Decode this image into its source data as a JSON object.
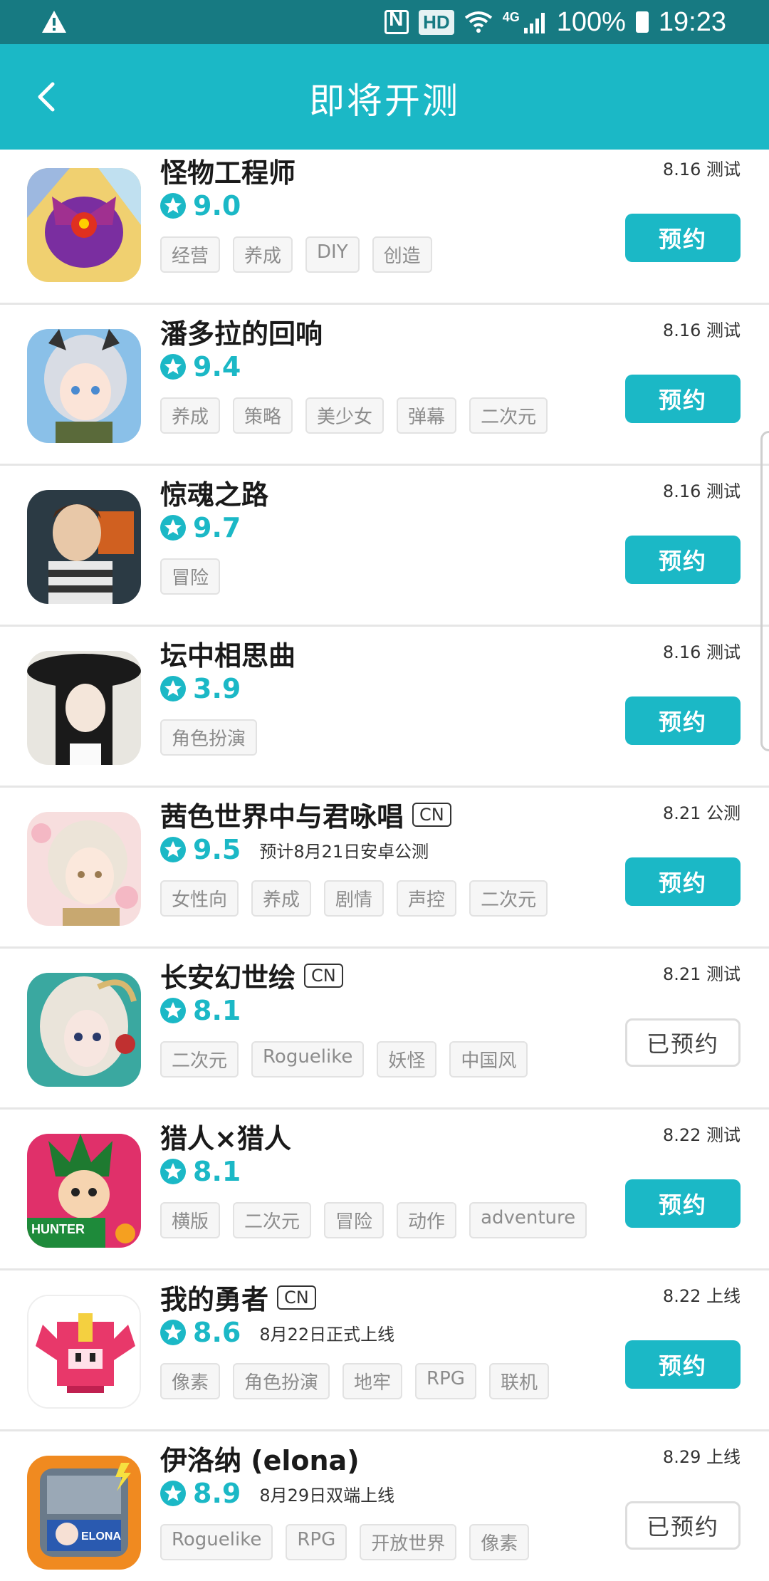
{
  "status_bar": {
    "battery": "100%",
    "time": "19:23",
    "network": "4G",
    "hd": "HD"
  },
  "header": {
    "title": "即将开测"
  },
  "games": [
    {
      "name": "怪物工程师",
      "cn": "",
      "score": "9.0",
      "note": "",
      "tags": [
        "经营",
        "养成",
        "DIY",
        "创造"
      ],
      "date": "8.16 测试",
      "button": "预约",
      "reserved": false
    },
    {
      "name": "潘多拉的回响",
      "cn": "",
      "score": "9.4",
      "note": "",
      "tags": [
        "养成",
        "策略",
        "美少女",
        "弹幕",
        "二次元"
      ],
      "date": "8.16 测试",
      "button": "预约",
      "reserved": false
    },
    {
      "name": "惊魂之路",
      "cn": "",
      "score": "9.7",
      "note": "",
      "tags": [
        "冒险"
      ],
      "date": "8.16 测试",
      "button": "预约",
      "reserved": false
    },
    {
      "name": "坛中相思曲",
      "cn": "",
      "score": "3.9",
      "note": "",
      "tags": [
        "角色扮演"
      ],
      "date": "8.16 测试",
      "button": "预约",
      "reserved": false
    },
    {
      "name": "茜色世界中与君咏唱",
      "cn": "CN",
      "score": "9.5",
      "note": "预计8月21日安卓公测",
      "tags": [
        "女性向",
        "养成",
        "剧情",
        "声控",
        "二次元"
      ],
      "date": "8.21 公测",
      "button": "预约",
      "reserved": false
    },
    {
      "name": "长安幻世绘",
      "cn": "CN",
      "score": "8.1",
      "note": "",
      "tags": [
        "二次元",
        "Roguelike",
        "妖怪",
        "中国风"
      ],
      "date": "8.21 测试",
      "button": "已预约",
      "reserved": true
    },
    {
      "name": "猎人×猎人",
      "cn": "",
      "score": "8.1",
      "note": "",
      "tags": [
        "横版",
        "二次元",
        "冒险",
        "动作",
        "adventure"
      ],
      "date": "8.22 测试",
      "button": "预约",
      "reserved": false
    },
    {
      "name": "我的勇者",
      "cn": "CN",
      "score": "8.6",
      "note": "8月22日正式上线",
      "tags": [
        "像素",
        "角色扮演",
        "地牢",
        "RPG",
        "联机"
      ],
      "date": "8.22 上线",
      "button": "预约",
      "reserved": false
    },
    {
      "name": "伊洛纳 (elona)",
      "cn": "",
      "score": "8.9",
      "note": "8月29日双端上线",
      "tags": [
        "Roguelike",
        "RPG",
        "开放世界",
        "像素"
      ],
      "date": "8.29 上线",
      "button": "已预约",
      "reserved": true
    }
  ],
  "icon_art": {
    "hunter_logo": "HUNTER HUNTER",
    "elona_logo": "ELONA"
  },
  "colors": {
    "accent": "#1bb8c6",
    "status_bar": "#177a82"
  }
}
